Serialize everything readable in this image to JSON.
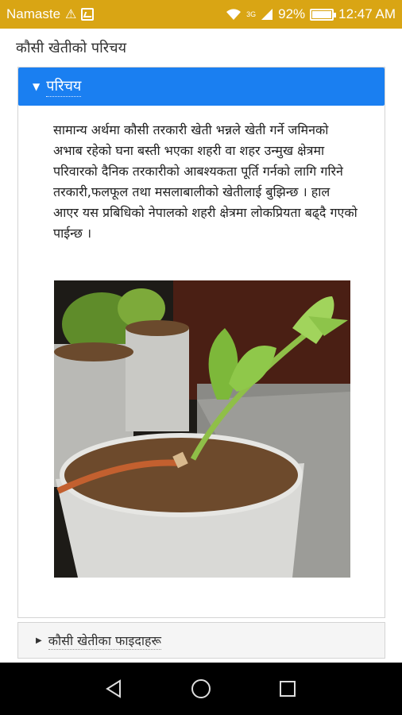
{
  "status": {
    "app_name": "Namaste",
    "network": "3G",
    "battery": "92%",
    "time": "12:47 AM"
  },
  "page_title": "कौसी खेतीको परिचय",
  "section1": {
    "title": "परिचय",
    "paragraph": "सामान्य अर्थमा कौसी तरकारी खेती भन्नले खेती गर्ने जमिनको अभाब रहेको घना बस्ती भएका शहरी वा शहर उन्मुख क्षेत्रमा परिवारको दैनिक तरकारीको आबश्यकता पूर्ति गर्नको लागि गरिने तरकारी,फलफूल तथा मसलाबालीको खेतीलाई बुझिन्छ । हाल आएर यस प्रबिधिको नेपालको शहरी क्षेत्रमा लोकप्रियता बढ्दै गएको पाईन्छ ।"
  },
  "section2": {
    "title": "कौसी खेतीका फाइदाहरू"
  },
  "colors": {
    "status_bar": "#d9a514",
    "accent": "#1a7ff1",
    "nav_bar": "#000000"
  }
}
